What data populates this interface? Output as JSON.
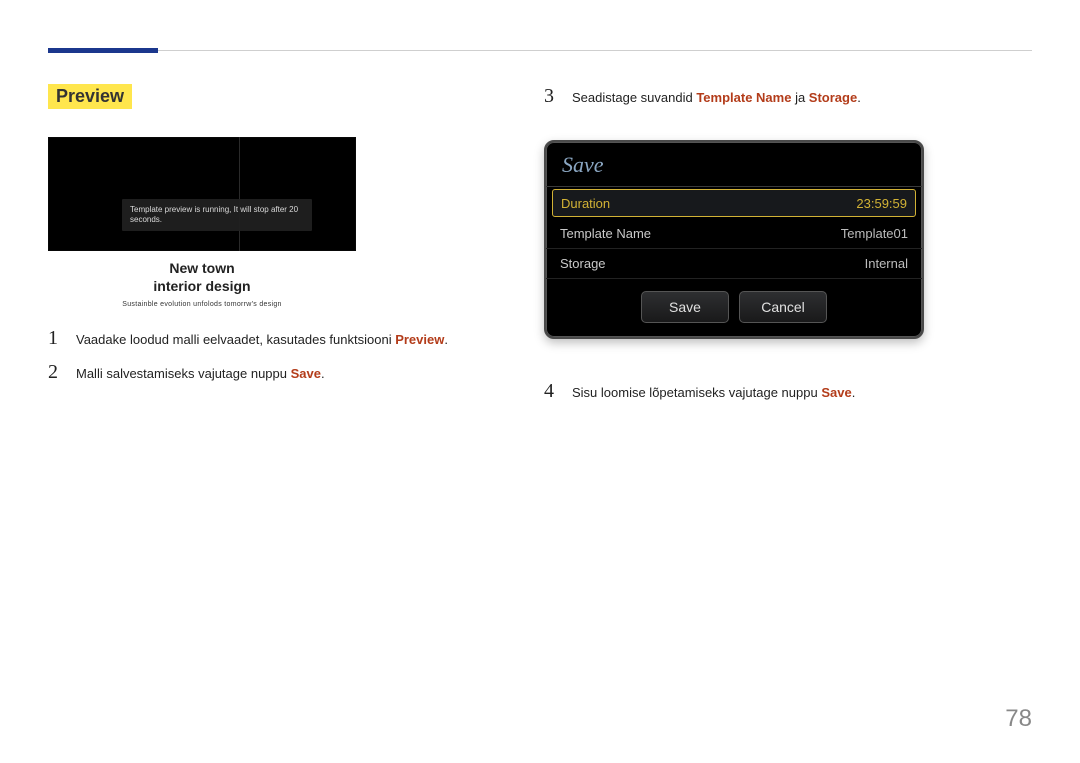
{
  "section_title": "Preview",
  "preview_image": {
    "toast": "Template preview is running, It will stop after 20 seconds.",
    "caption_line1": "New town",
    "caption_line2": "interior design",
    "tagline": "Sustainble evolution unfolods tomorrw's design"
  },
  "left_steps": [
    {
      "num": "1",
      "prefix": "Vaadake loodud malli eelvaadet, kasutades funktsiooni ",
      "kw": "Preview",
      "suffix": "."
    },
    {
      "num": "2",
      "prefix": "Malli salvestamiseks vajutage nuppu ",
      "kw": "Save",
      "suffix": "."
    }
  ],
  "right_steps": [
    {
      "num": "3",
      "prefix": "Seadistage suvandid ",
      "kw": "Template Name",
      "mid": " ja ",
      "kw2": "Storage",
      "suffix": "."
    },
    {
      "num": "4",
      "prefix": "Sisu loomise lõpetamiseks vajutage nuppu ",
      "kw": "Save",
      "suffix": "."
    }
  ],
  "save_dialog": {
    "title": "Save",
    "rows": [
      {
        "label": "Duration",
        "value": "23:59:59",
        "selected": true
      },
      {
        "label": "Template Name",
        "value": "Template01",
        "selected": false
      },
      {
        "label": "Storage",
        "value": "Internal",
        "selected": false
      }
    ],
    "buttons": {
      "save": "Save",
      "cancel": "Cancel"
    }
  },
  "page_number": "78"
}
